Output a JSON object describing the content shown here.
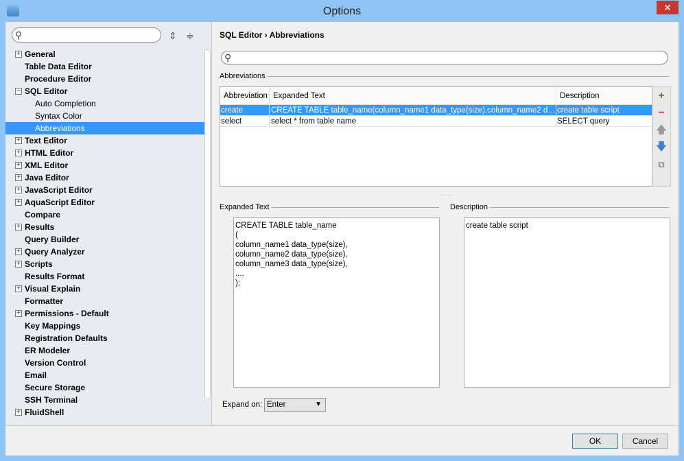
{
  "window": {
    "title": "Options",
    "close": "✕"
  },
  "tree": {
    "items": [
      {
        "label": "General",
        "exp": "+"
      },
      {
        "label": "Table Data Editor"
      },
      {
        "label": "Procedure Editor"
      },
      {
        "label": "SQL Editor",
        "exp": "−"
      },
      {
        "label": "Auto Completion",
        "sub": true
      },
      {
        "label": "Syntax Color",
        "sub": true
      },
      {
        "label": "Abbreviations",
        "sub": true,
        "selected": true
      },
      {
        "label": "Text Editor",
        "exp": "+"
      },
      {
        "label": "HTML Editor",
        "exp": "+"
      },
      {
        "label": "XML Editor",
        "exp": "+"
      },
      {
        "label": "Java Editor",
        "exp": "+"
      },
      {
        "label": "JavaScript Editor",
        "exp": "+"
      },
      {
        "label": "AquaScript Editor",
        "exp": "+"
      },
      {
        "label": "Compare"
      },
      {
        "label": "Results",
        "exp": "+"
      },
      {
        "label": "Query Builder"
      },
      {
        "label": "Query Analyzer",
        "exp": "+"
      },
      {
        "label": "Scripts",
        "exp": "+"
      },
      {
        "label": "Results Format"
      },
      {
        "label": "Visual Explain",
        "exp": "+"
      },
      {
        "label": "Formatter"
      },
      {
        "label": "Permissions - Default",
        "exp": "+"
      },
      {
        "label": "Key Mappings"
      },
      {
        "label": "Registration Defaults"
      },
      {
        "label": "ER Modeler"
      },
      {
        "label": "Version Control"
      },
      {
        "label": "Email"
      },
      {
        "label": "Secure Storage"
      },
      {
        "label": "SSH Terminal"
      },
      {
        "label": "FluidShell",
        "exp": "+"
      }
    ]
  },
  "breadcrumb": "SQL Editor › Abbreviations",
  "abbrev": {
    "group": "Abbreviations",
    "headers": [
      "Abbreviation",
      "Expanded Text",
      "Description"
    ],
    "rows": [
      [
        "create",
        "CREATE TABLE table_name(column_name1 data_type(size),column_name2 data_type(size),column_name3 data_type(size),....);",
        "create table script"
      ],
      [
        "select",
        "select * from table name",
        "SELECT query"
      ]
    ]
  },
  "expanded": {
    "label": "Expanded Text",
    "value": "CREATE TABLE table_name\n(\ncolumn_name1 data_type(size),\ncolumn_name2 data_type(size),\ncolumn_name3 data_type(size),\n....\n);"
  },
  "description": {
    "label": "Description",
    "value": "create table script"
  },
  "expand_on": {
    "label": "Expand on:",
    "value": "Enter"
  },
  "buttons": {
    "ok": "OK",
    "cancel": "Cancel"
  }
}
